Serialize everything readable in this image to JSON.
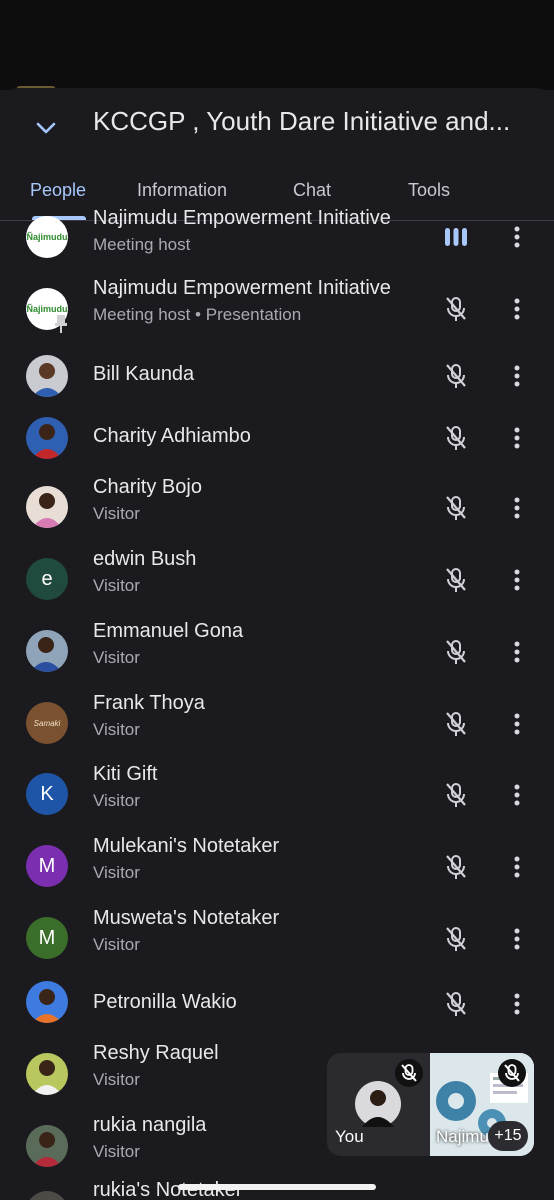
{
  "meeting": {
    "title": "KCCGP , Youth Dare Initiative and..."
  },
  "tabs": [
    {
      "label": "People",
      "active": true
    },
    {
      "label": "Information",
      "active": false
    },
    {
      "label": "Chat",
      "active": false
    },
    {
      "label": "Tools",
      "active": false
    }
  ],
  "participants": [
    {
      "name": "Najimudu Empowerment Initiative",
      "role": "Meeting host",
      "avatar": "najimudu-logo",
      "mic": "speaking",
      "pinned": false
    },
    {
      "name": "Najimudu Empowerment Initiative",
      "role": "Meeting host • Presentation",
      "avatar": "najimudu-logo",
      "mic": "muted",
      "pinned": true
    },
    {
      "name": "Bill Kaunda",
      "role": "",
      "avatar": "photo",
      "mic": "muted"
    },
    {
      "name": "Charity Adhiambo",
      "role": "",
      "avatar": "photo",
      "mic": "muted"
    },
    {
      "name": "Charity Bojo",
      "role": "Visitor",
      "avatar": "photo",
      "mic": "muted"
    },
    {
      "name": "edwin Bush",
      "role": "Visitor",
      "avatar_letter": "e",
      "mic": "muted"
    },
    {
      "name": "Emmanuel Gona",
      "role": "Visitor",
      "avatar": "photo",
      "mic": "muted"
    },
    {
      "name": "Frank Thoya",
      "role": "Visitor",
      "avatar": "samaki-logo",
      "avatar_text": "Samaki",
      "mic": "muted"
    },
    {
      "name": "Kiti Gift",
      "role": "Visitor",
      "avatar_letter": "K",
      "mic": "muted"
    },
    {
      "name": "Mulekani's Notetaker",
      "role": "Visitor",
      "avatar_letter": "M",
      "mic": "muted"
    },
    {
      "name": "Musweta's Notetaker",
      "role": "Visitor",
      "avatar_letter": "M",
      "mic": "muted"
    },
    {
      "name": "Petronilla Wakio",
      "role": "",
      "avatar": "photo",
      "mic": "muted"
    },
    {
      "name": "Reshy Raquel",
      "role": "Visitor",
      "avatar": "photo",
      "mic": "muted"
    },
    {
      "name": "rukia nangila",
      "role": "Visitor",
      "avatar": "photo",
      "mic": "muted"
    },
    {
      "name": "rukia's Notetaker",
      "role": "",
      "avatar": "photo",
      "mic": "muted"
    }
  ],
  "logo_text": "Ñajimudu",
  "pip": {
    "self_label": "You",
    "presenter_label": "Najimu",
    "more_count": "+15"
  },
  "colors": {
    "background": "#1b1b1f",
    "accent": "#a8c7fa",
    "avatar_e": "#1f4a3d",
    "avatar_k": "#1f55a6",
    "avatar_m1": "#7b2fb0",
    "avatar_m2": "#3b6e2a"
  }
}
